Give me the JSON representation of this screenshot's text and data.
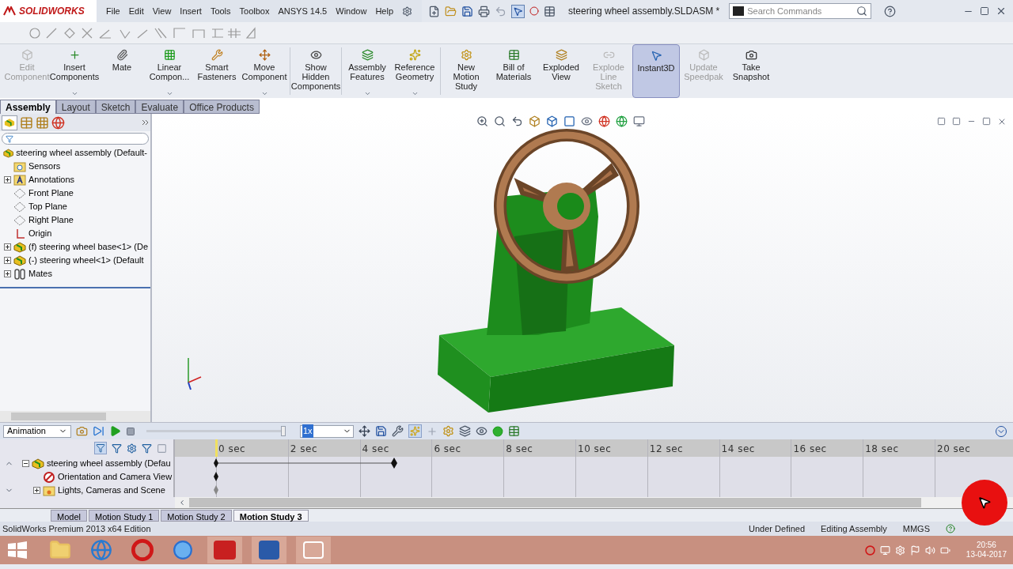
{
  "app": {
    "logo": "SOLIDWORKS",
    "menu": [
      "File",
      "Edit",
      "View",
      "Insert",
      "Tools",
      "Toolbox",
      "ANSYS 14.5",
      "Window",
      "Help"
    ],
    "document_title": "steering wheel assembly.SLDASM *",
    "search": {
      "placeholder": "Search Commands"
    }
  },
  "ribbon": [
    {
      "label": "Edit Component",
      "disabled": true,
      "dropdown": false,
      "selected": false
    },
    {
      "label": "Insert Components",
      "disabled": false,
      "dropdown": true,
      "selected": false
    },
    {
      "label": "Mate",
      "disabled": false,
      "dropdown": false,
      "selected": false
    },
    {
      "label": "Linear Compon...",
      "disabled": false,
      "dropdown": true,
      "selected": false
    },
    {
      "label": "Smart Fasteners",
      "disabled": false,
      "dropdown": false,
      "selected": false
    },
    {
      "label": "Move Component",
      "disabled": false,
      "dropdown": true,
      "selected": false
    },
    {
      "label": "Show Hidden Components",
      "disabled": false,
      "dropdown": false,
      "selected": false
    },
    {
      "label": "Assembly Features",
      "disabled": false,
      "dropdown": true,
      "selected": false
    },
    {
      "label": "Reference Geometry",
      "disabled": false,
      "dropdown": true,
      "selected": false
    },
    {
      "label": "New Motion Study",
      "disabled": false,
      "dropdown": false,
      "selected": false
    },
    {
      "label": "Bill of Materials",
      "disabled": false,
      "dropdown": false,
      "selected": false
    },
    {
      "label": "Exploded View",
      "disabled": false,
      "dropdown": false,
      "selected": false
    },
    {
      "label": "Explode Line Sketch",
      "disabled": true,
      "dropdown": false,
      "selected": false
    },
    {
      "label": "Instant3D",
      "disabled": false,
      "dropdown": false,
      "selected": true
    },
    {
      "label": "Update Speedpak",
      "disabled": true,
      "dropdown": false,
      "selected": false
    },
    {
      "label": "Take Snapshot",
      "disabled": false,
      "dropdown": false,
      "selected": false
    }
  ],
  "command_tabs": [
    {
      "label": "Assembly",
      "selected": true
    },
    {
      "label": "Layout",
      "selected": false
    },
    {
      "label": "Sketch",
      "selected": false
    },
    {
      "label": "Evaluate",
      "selected": false
    },
    {
      "label": "Office Products",
      "selected": false
    }
  ],
  "feature_tree": {
    "root": {
      "label": "steering wheel assembly  (Default-",
      "kind": "assembly"
    },
    "children": [
      {
        "label": "Sensors",
        "kind": "sensor",
        "expandable": false
      },
      {
        "label": "Annotations",
        "kind": "annotation",
        "expandable": true
      },
      {
        "label": "Front Plane",
        "kind": "plane",
        "expandable": false
      },
      {
        "label": "Top Plane",
        "kind": "plane",
        "expandable": false
      },
      {
        "label": "Right Plane",
        "kind": "plane",
        "expandable": false
      },
      {
        "label": "Origin",
        "kind": "origin",
        "expandable": false
      },
      {
        "label": "(f) steering wheel base<1> (De",
        "kind": "part",
        "expandable": true
      },
      {
        "label": "(-) steering wheel<1> (Default",
        "kind": "part",
        "expandable": true
      },
      {
        "label": "Mates",
        "kind": "mates",
        "expandable": true
      }
    ]
  },
  "motion": {
    "mode": "Animation",
    "speed": "1x",
    "playback": {
      "level": 1
    },
    "ticks": [
      "0 sec",
      "2 sec",
      "4 sec",
      "6 sec",
      "8 sec",
      "10 sec",
      "12 sec",
      "14 sec",
      "16 sec",
      "18 sec",
      "20 sec"
    ],
    "tracks": [
      {
        "label": "steering wheel assembly  (Defau",
        "kind": "assembly",
        "expandable": true,
        "expanded": true
      },
      {
        "label": "Orientation and Camera View",
        "kind": "camera",
        "expandable": false
      },
      {
        "label": "Lights, Cameras and Scene",
        "kind": "lights",
        "expandable": true,
        "expanded": false
      }
    ],
    "tabs": [
      {
        "label": "Model",
        "selected": false
      },
      {
        "label": "Motion Study 1",
        "selected": false
      },
      {
        "label": "Motion Study 2",
        "selected": false
      },
      {
        "label": "Motion Study 3",
        "selected": true
      }
    ]
  },
  "status_bar": {
    "edition": "SolidWorks Premium 2013 x64 Edition",
    "items": [
      "Under Defined",
      "Editing Assembly",
      "MMGS"
    ]
  },
  "taskbar": {
    "time": "20:56",
    "date": "13-04-2017"
  }
}
